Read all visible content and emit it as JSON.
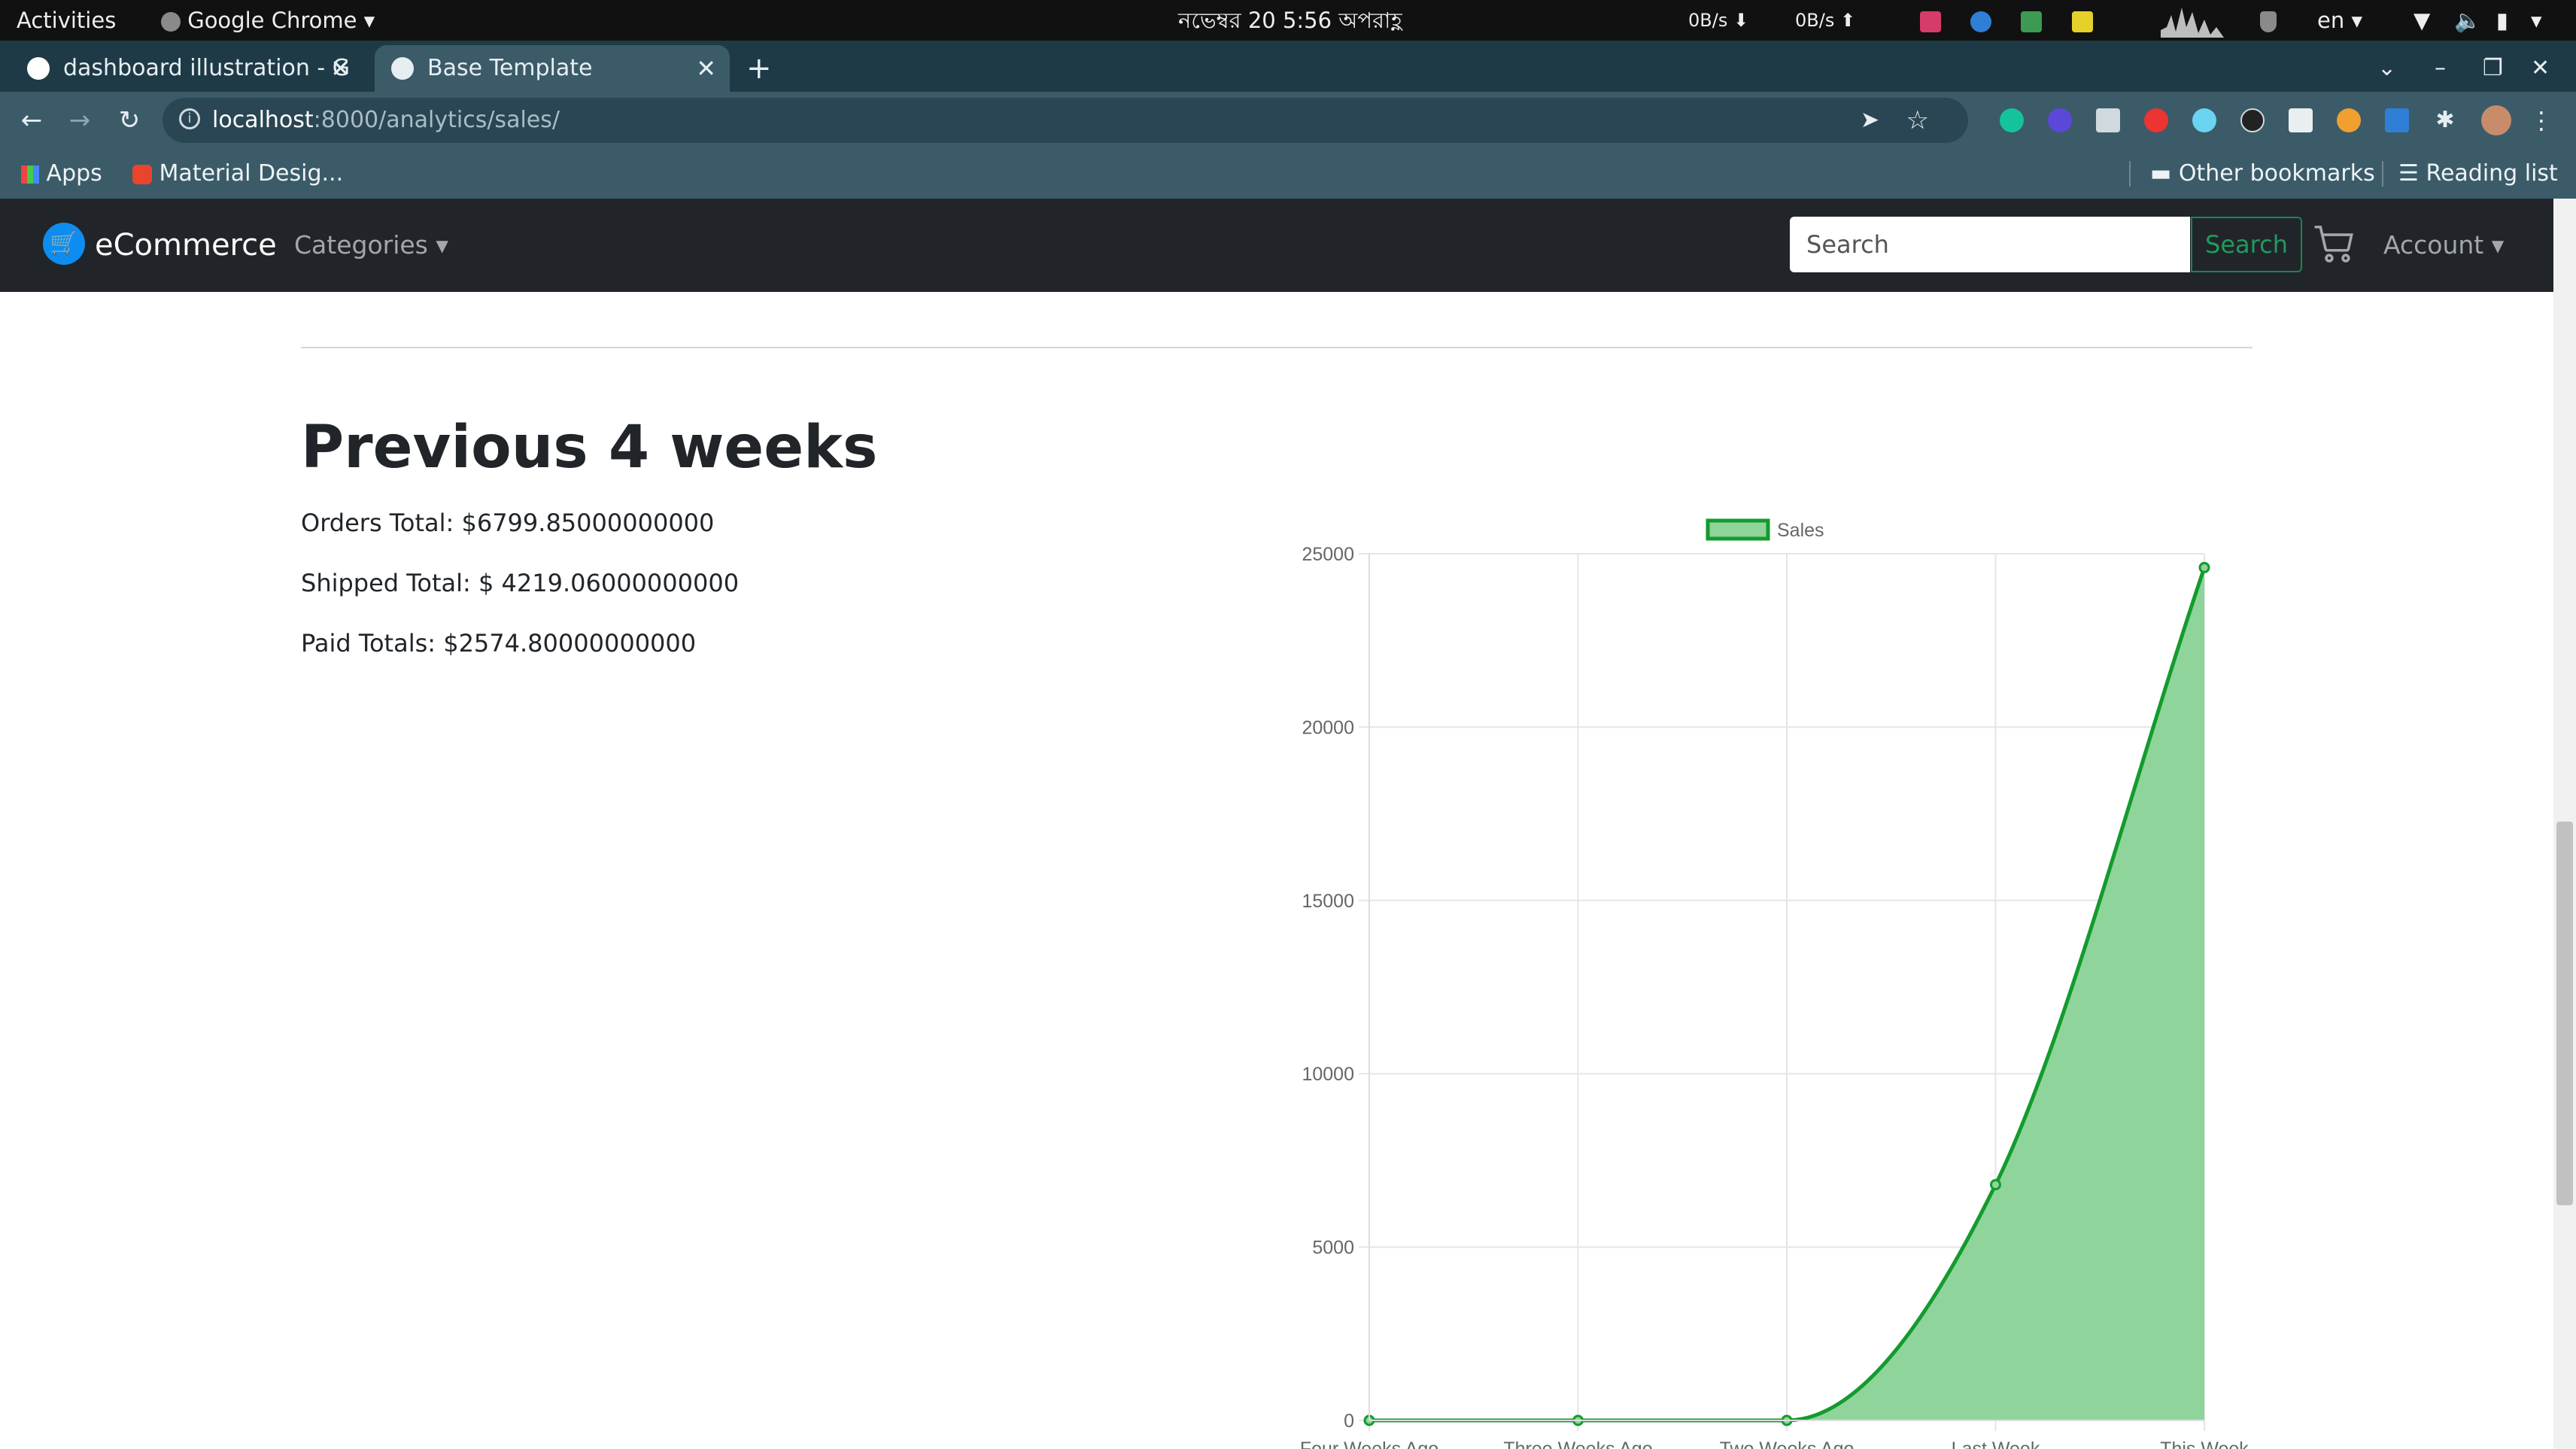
{
  "system_bar": {
    "activities": "Activities",
    "app_name": "Google Chrome",
    "datetime": "নভেম্বর 20   5:56 অপরাহ্ণ",
    "net_down": "0B/s",
    "net_up": "0B/s",
    "language": "en"
  },
  "browser": {
    "tabs": [
      {
        "title": "dashboard illustration - G",
        "active": false
      },
      {
        "title": "Base Template",
        "active": true
      }
    ],
    "url_host": "localhost",
    "url_path": ":8000/analytics/sales/",
    "bookmarks": {
      "apps": "Apps",
      "material": "Material Desig...",
      "other": "Other bookmarks",
      "reading_list": "Reading list"
    }
  },
  "navbar": {
    "brand": "eCommerce",
    "categories": "Categories",
    "search_placeholder": "Search",
    "search_button": "Search",
    "account": "Account"
  },
  "page": {
    "title": "Previous 4 weeks",
    "orders_total": "Orders Total: $6799.85000000000",
    "shipped_total": "Shipped Total: $ 4219.06000000000",
    "paid_totals": "Paid Totals: $2574.80000000000"
  },
  "colors": {
    "series_line": "#139b2e",
    "series_fill": "#8fd49a",
    "navbar_bg": "#212529",
    "browser_chrome": "#3b5b69"
  },
  "chart_data": {
    "type": "area",
    "categories": [
      "Four Weeks Ago",
      "Three Weeks Ago",
      "Two Weeks Ago",
      "Last Week",
      "This Week"
    ],
    "series": [
      {
        "name": "Sales",
        "values": [
          0,
          0,
          0,
          6800,
          24600
        ]
      }
    ],
    "yticks": [
      "0",
      "5000",
      "10000",
      "15000",
      "20000",
      "25000"
    ],
    "ylim": [
      0,
      25000
    ],
    "grid": true,
    "legend_position": "top"
  }
}
